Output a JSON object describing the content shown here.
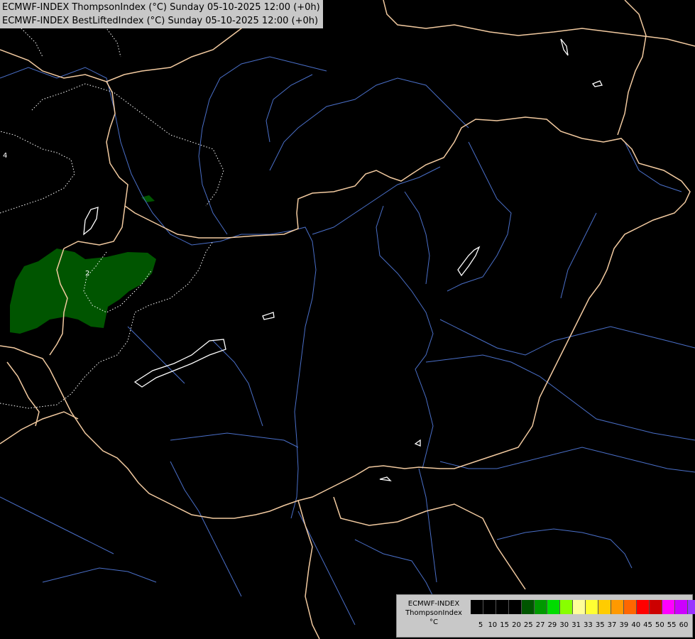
{
  "header": {
    "line1": "ECMWF-INDEX ThompsonIndex (°C) Sunday 05-10-2025 12:00 (+0h)",
    "line2": "ECMWF-INDEX BestLiftedIndex (°C) Sunday 05-10-2025 12:00 (+0h)"
  },
  "map": {
    "background": "#000000",
    "border_color": "#f2caa0",
    "river_color": "#4a6fc8",
    "lake_color": "#ffffff",
    "contour_color": "#ffffff",
    "contour_labels": [
      "4",
      "2"
    ],
    "thompson_area_color": "#005500"
  },
  "legend": {
    "caption_lines": [
      "ECMWF-INDEX",
      "ThompsonIndex",
      "°C"
    ],
    "swatch_colors": [
      "#000000",
      "#000000",
      "#000000",
      "#000000",
      "#005500",
      "#009900",
      "#00dd00",
      "#88ff00",
      "#ffff99",
      "#ffff33",
      "#ffcc00",
      "#ff9900",
      "#ff6600",
      "#ff0000",
      "#cc0000",
      "#ff00ff",
      "#cc00ff",
      "#9933ff",
      "#6633ff",
      "#0000ff"
    ],
    "ticks": [
      "5",
      "10",
      "15",
      "20",
      "25",
      "27",
      "29",
      "30",
      "31",
      "33",
      "35",
      "37",
      "39",
      "40",
      "45",
      "50",
      "55",
      "60"
    ]
  }
}
